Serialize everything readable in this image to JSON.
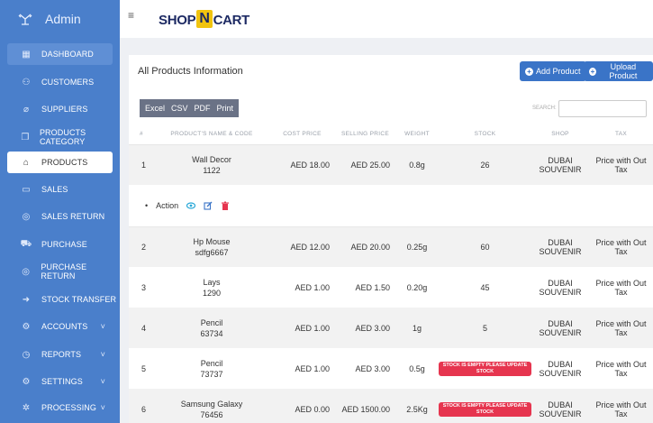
{
  "sidebar": {
    "title": "Admin",
    "items": [
      {
        "label": "DASHBOARD",
        "icon": "grid-icon"
      },
      {
        "label": "CUSTOMERS",
        "icon": "users-icon"
      },
      {
        "label": "SUPPLIERS",
        "icon": "tag-icon"
      },
      {
        "label": "PRODUCTS CATEGORY",
        "icon": "copy-icon"
      },
      {
        "label": "PRODUCTS",
        "icon": "bag-icon"
      },
      {
        "label": "SALES",
        "icon": "calendar-icon"
      },
      {
        "label": "SALES RETURN",
        "icon": "return-icon"
      },
      {
        "label": "PURCHASE",
        "icon": "cart-icon"
      },
      {
        "label": "PURCHASE RETURN",
        "icon": "return-icon"
      },
      {
        "label": "STOCK TRANSFER",
        "icon": "arrow-right-icon"
      },
      {
        "label": "ACCOUNTS",
        "icon": "gear-icon"
      },
      {
        "label": "REPORTS",
        "icon": "clock-icon"
      },
      {
        "label": "SETTINGS",
        "icon": "gear-icon"
      },
      {
        "label": "PROCESSING",
        "icon": "cogs-icon"
      }
    ]
  },
  "topbar": {
    "brand_left": "SHOP",
    "brand_mid": "N",
    "brand_right": "CART"
  },
  "card": {
    "title": "All Products Information",
    "add_label": "Add Product",
    "upload_label": "Upload Product"
  },
  "export": {
    "excel": "Excel",
    "csv": "CSV",
    "pdf": "PDF",
    "print": "Print"
  },
  "search": {
    "label": "SEARCH:",
    "value": ""
  },
  "table": {
    "headers": [
      "#",
      "PRODUCT'S NAME & CODE",
      "COST PRICE",
      "SELLING PRICE",
      "WEIGHT",
      "STOCK",
      "SHOP",
      "TAX"
    ],
    "action_label": "Action",
    "rows": [
      {
        "num": "1",
        "name": "Wall Decor",
        "code": "1122",
        "cost": "AED 18.00",
        "sell": "AED 25.00",
        "weight": "0.8g",
        "stock": "26",
        "shop": "DUBAI SOUVENIR",
        "tax": "Price with Out Tax"
      },
      {
        "num": "2",
        "name": "Hp Mouse",
        "code": "sdfg6667",
        "cost": "AED 12.00",
        "sell": "AED 20.00",
        "weight": "0.25g",
        "stock": "60",
        "shop": "DUBAI SOUVENIR",
        "tax": "Price with Out Tax"
      },
      {
        "num": "3",
        "name": "Lays",
        "code": "1290",
        "cost": "AED 1.00",
        "sell": "AED 1.50",
        "weight": "0.20g",
        "stock": "45",
        "shop": "DUBAI SOUVENIR",
        "tax": "Price with Out Tax"
      },
      {
        "num": "4",
        "name": "Pencil",
        "code": "63734",
        "cost": "AED 1.00",
        "sell": "AED 3.00",
        "weight": "1g",
        "stock": "5",
        "shop": "DUBAI SOUVENIR",
        "tax": "Price with Out Tax"
      },
      {
        "num": "5",
        "name": "Pencil",
        "code": "73737",
        "cost": "AED 1.00",
        "sell": "AED 3.00",
        "weight": "0.5g",
        "stock_badge": "STOCK IS EMPTY PLEASE UPDATE STOCK",
        "shop": "DUBAI SOUVENIR",
        "tax": "Price with Out Tax"
      },
      {
        "num": "6",
        "name": "Samsung Galaxy",
        "code": "76456",
        "cost": "AED 0.00",
        "sell": "AED 1500.00",
        "weight": "2.5Kg",
        "stock_badge": "STOCK IS EMPTY PLEASE UPDATE STOCK",
        "shop": "DUBAI SOUVENIR",
        "tax": "Price with Out Tax"
      }
    ]
  },
  "colors": {
    "sidebar": "#4a7fcb",
    "primary_button": "#3a74c7",
    "danger_badge": "#e6354f",
    "brand_yellow": "#f1c40f"
  }
}
